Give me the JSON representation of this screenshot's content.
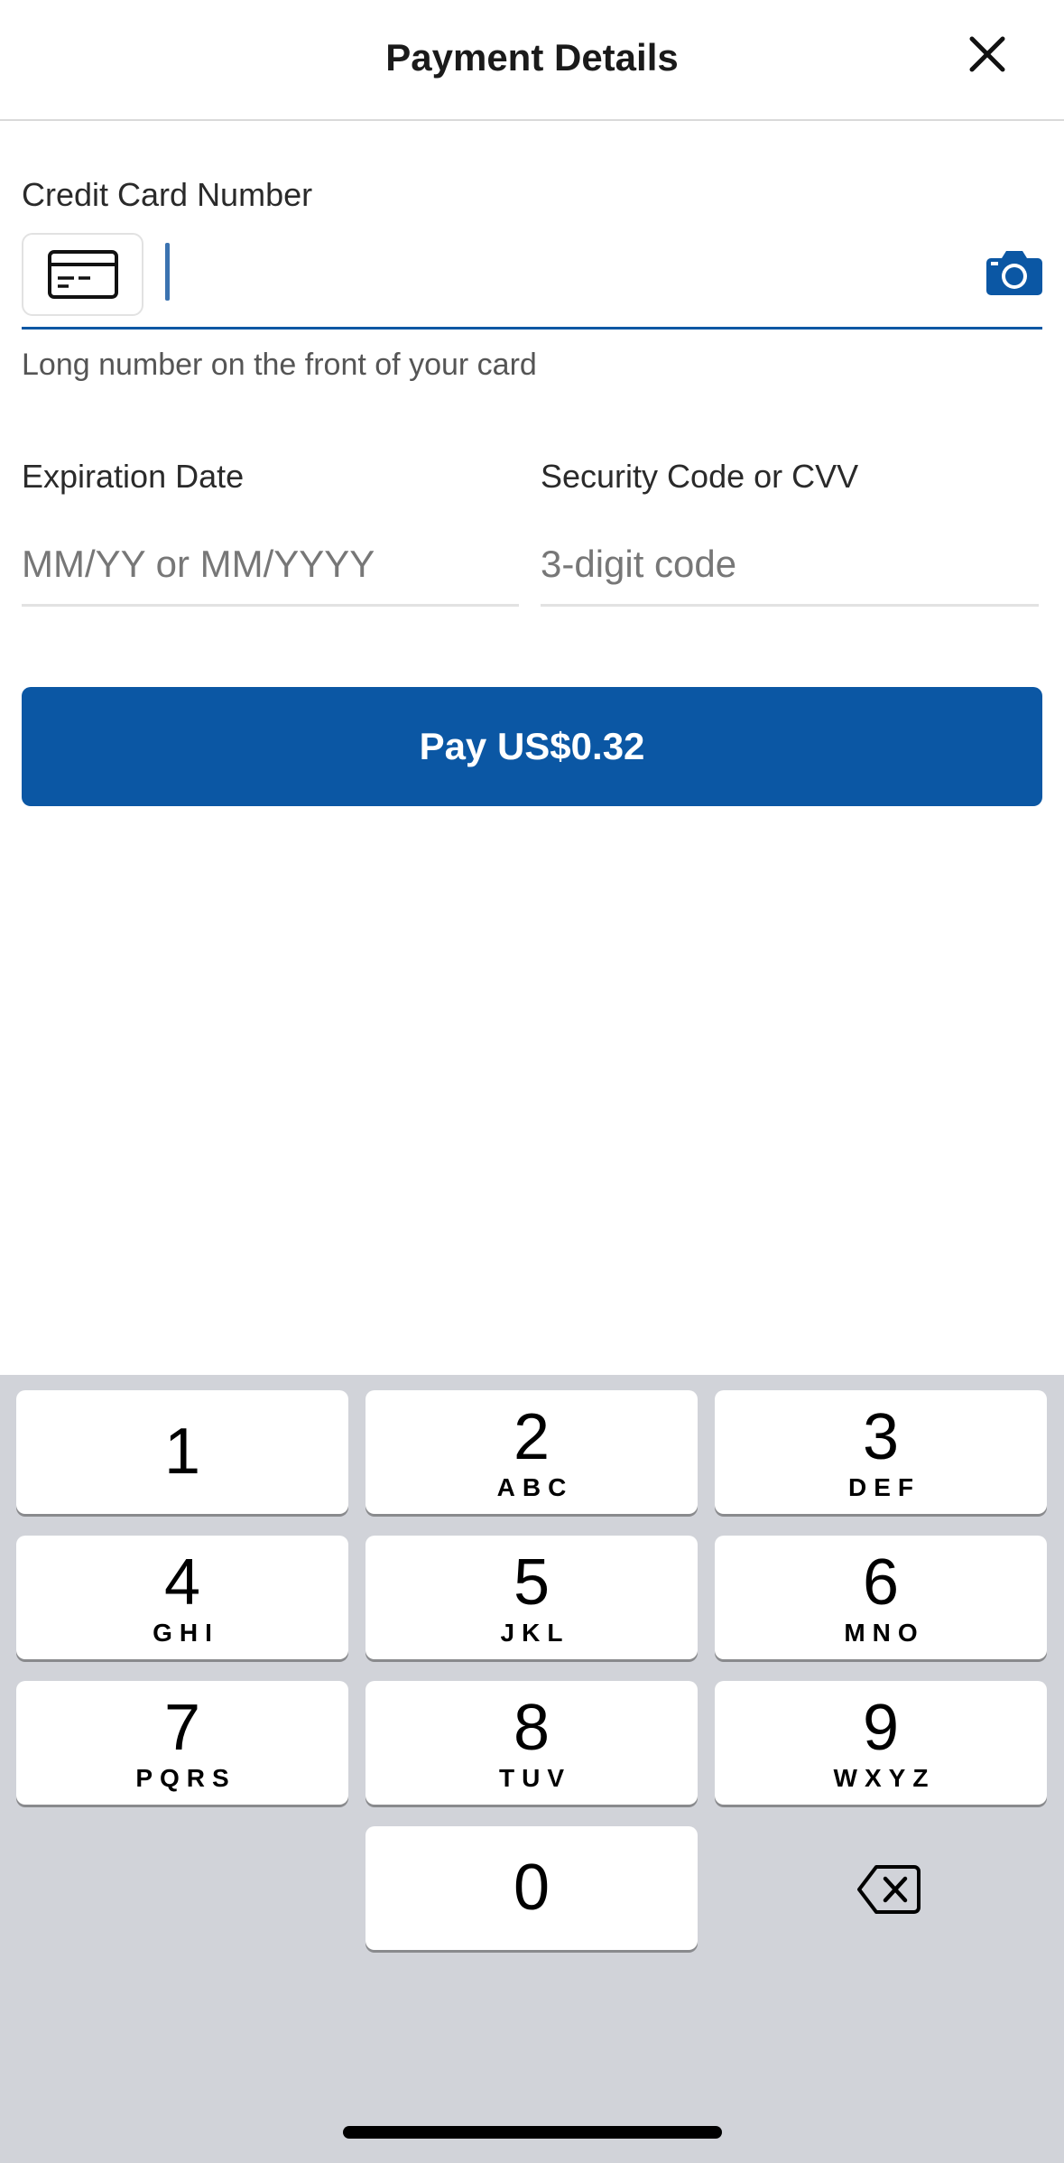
{
  "header": {
    "title": "Payment Details",
    "close_icon": "close-icon"
  },
  "card": {
    "label": "Credit Card Number",
    "value": "",
    "placeholder": "",
    "help": "Long number on the front of your card",
    "card_icon": "credit-card-icon",
    "camera_icon": "camera-icon"
  },
  "expiration": {
    "label": "Expiration Date",
    "placeholder": "MM/YY or MM/YYYY"
  },
  "cvv": {
    "label": "Security Code or CVV",
    "placeholder": "3-digit code"
  },
  "pay_button": {
    "label": "Pay US$0.32"
  },
  "keypad": {
    "keys": [
      {
        "digit": "1",
        "letters": ""
      },
      {
        "digit": "2",
        "letters": "ABC"
      },
      {
        "digit": "3",
        "letters": "DEF"
      },
      {
        "digit": "4",
        "letters": "GHI"
      },
      {
        "digit": "5",
        "letters": "JKL"
      },
      {
        "digit": "6",
        "letters": "MNO"
      },
      {
        "digit": "7",
        "letters": "PQRS"
      },
      {
        "digit": "8",
        "letters": "TUV"
      },
      {
        "digit": "9",
        "letters": "WXYZ"
      },
      {
        "digit": "0",
        "letters": ""
      }
    ],
    "backspace_icon": "backspace-icon"
  },
  "colors": {
    "accent": "#0b57a4",
    "keypad_bg": "#d1d3d9",
    "key_bg": "#ffffff"
  }
}
